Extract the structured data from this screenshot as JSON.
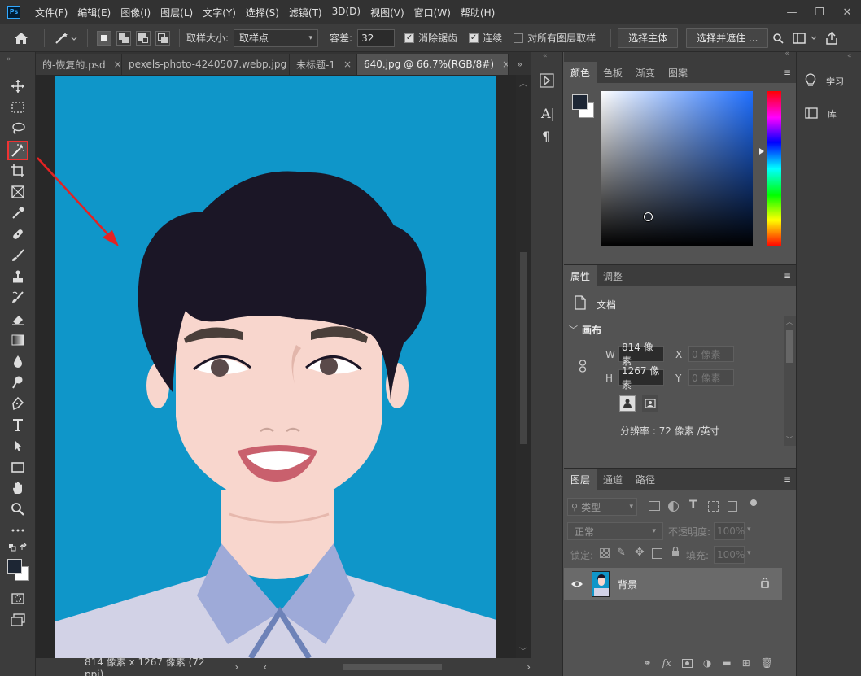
{
  "app": {
    "logo_text": "Ps"
  },
  "menu": [
    "文件(F)",
    "编辑(E)",
    "图像(I)",
    "图层(L)",
    "文字(Y)",
    "选择(S)",
    "滤镜(T)",
    "3D(D)",
    "视图(V)",
    "窗口(W)",
    "帮助(H)"
  ],
  "window_controls": {
    "minimize": "—",
    "restore": "❐",
    "close": "✕"
  },
  "options": {
    "sample_size_label": "取样大小:",
    "sample_size_value": "取样点",
    "tolerance_label": "容差:",
    "tolerance_value": "32",
    "antialias_label": "消除锯齿",
    "contiguous_label": "连续",
    "sample_all_label": "对所有图层取样",
    "select_subject": "选择主体",
    "select_mask": "选择并遮住 ..."
  },
  "tabs": [
    {
      "label": "的-恢复的.psd",
      "active": false
    },
    {
      "label": "pexels-photo-4240507.webp.jpg",
      "active": false
    },
    {
      "label": "未标题-1",
      "active": false
    },
    {
      "label": "640.jpg @ 66.7%(RGB/8#)",
      "active": true
    }
  ],
  "status": {
    "text": "814 像素 x 1267 像素 (72 ppi)"
  },
  "color_panel": {
    "tabs": [
      "颜色",
      "色板",
      "渐变",
      "图案"
    ],
    "fg": "#1d2634",
    "bg": "#ffffff",
    "hue": "#1f6fff"
  },
  "properties": {
    "tabs": [
      "属性",
      "调整"
    ],
    "doc_label": "文档",
    "canvas_label": "画布",
    "w_label": "W",
    "w_value": "814 像素",
    "h_label": "H",
    "h_value": "1267 像素",
    "x_label": "X",
    "x_placeholder": "0 像素",
    "y_label": "Y",
    "y_placeholder": "0 像素",
    "resolution": "分辨率 : 72 像素 /英寸"
  },
  "layers": {
    "tabs": [
      "图层",
      "通道",
      "路径"
    ],
    "filter_label": "类型",
    "blend_mode": "正常",
    "opacity_label": "不透明度:",
    "opacity_value": "100%",
    "lock_label": "锁定:",
    "fill_label": "填充:",
    "fill_value": "100%",
    "items": [
      {
        "name": "背景",
        "visible": true,
        "locked": true
      }
    ]
  },
  "right_dock": {
    "learn": "学习",
    "library": "库"
  }
}
